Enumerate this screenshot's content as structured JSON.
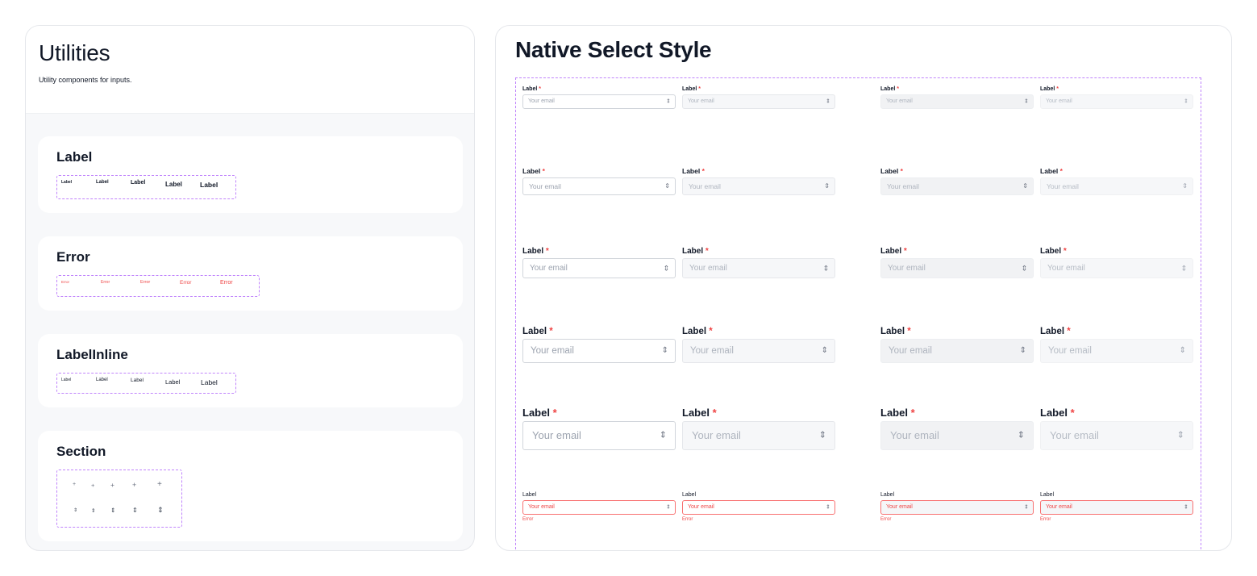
{
  "utilities": {
    "title": "Utilities",
    "description": "Utility components for inputs.",
    "cards": {
      "label": {
        "title": "Label",
        "samples": [
          "Label",
          "Label",
          "Label",
          "Label",
          "Label"
        ]
      },
      "error": {
        "title": "Error",
        "samples": [
          "Error",
          "Error",
          "Error",
          "Error",
          "Error"
        ]
      },
      "label_inline": {
        "title": "LabelInline",
        "samples": [
          "Label",
          "Label",
          "Label",
          "Label",
          "Label"
        ]
      },
      "section": {
        "title": "Section",
        "icons": [
          "plus-icon",
          "chevron-up-down-icon"
        ]
      }
    }
  },
  "native_select": {
    "title": "Native Select Style",
    "label_text": "Label",
    "required_mark": "*",
    "placeholder": "Your email",
    "error_text": "Error",
    "colors": {
      "accent_dashed": "#c084fc",
      "error": "#ef4444",
      "text": "#111827",
      "placeholder": "#9ca3af"
    }
  }
}
